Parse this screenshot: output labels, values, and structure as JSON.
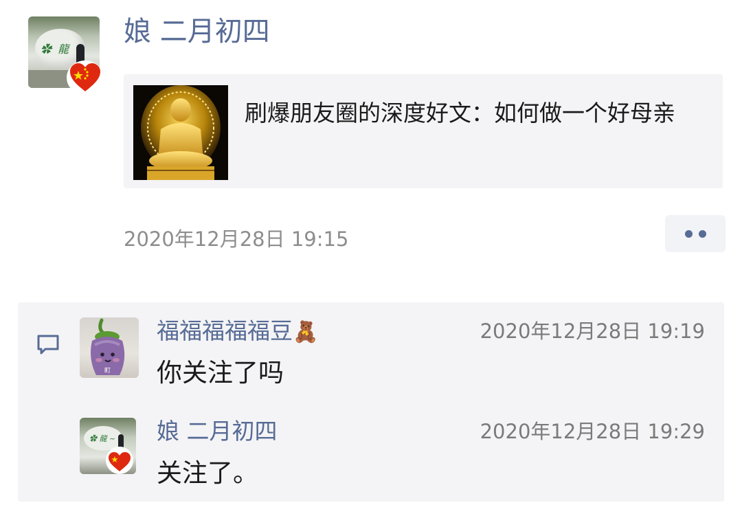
{
  "post": {
    "author": "娘 二月初四",
    "avatar_icon": "landscape-avatar-with-flag-badge",
    "link_card": {
      "title": "刷爆朋友圈的深度好文：如何做一个好母亲",
      "thumbnail_icon": "golden-buddha-image"
    },
    "timestamp": "2020年12月28日 19:15",
    "more_icon": "two-dots-more-icon"
  },
  "comments_icon": "comment-bubble-icon",
  "comments": [
    {
      "author": "福福福福福豆",
      "author_emoji": "🧸",
      "avatar_icon": "eggplant-plush-avatar",
      "avatar_caption": "町",
      "time": "2020年12月28日 19:19",
      "text": "你关注了吗"
    },
    {
      "author": "娘 二月初四",
      "avatar_icon": "landscape-avatar-with-flag-badge",
      "time": "2020年12月28日 19:29",
      "text": "关注了。"
    }
  ],
  "colors": {
    "link_blue": "#576b95",
    "card_bg": "#f4f4f6",
    "flag_red": "#de2910",
    "flag_star": "#ffde00"
  }
}
